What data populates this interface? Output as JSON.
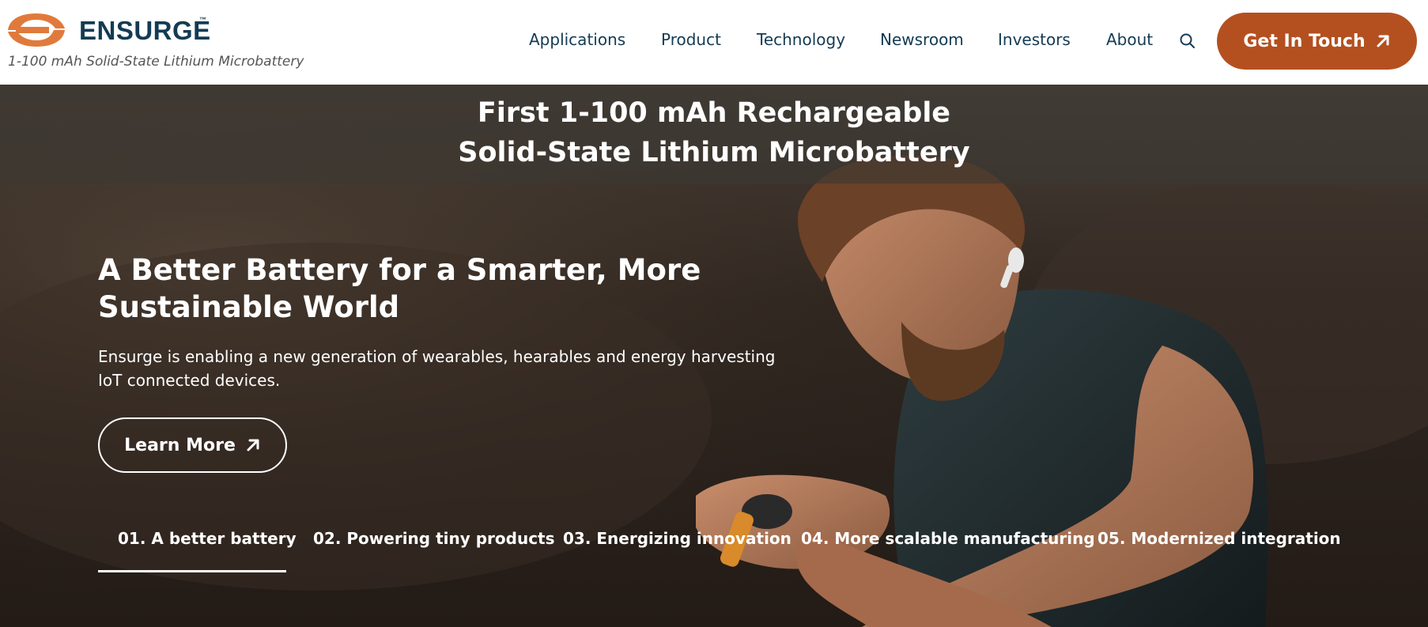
{
  "brand": {
    "name": "ENSURGE",
    "trademark": "™",
    "tagline": "1-100 mAh Solid-State Lithium Microbattery",
    "logo_icon": "ensurge-logo-mark",
    "colors": {
      "primary": "#143b54",
      "accent": "#b4501f",
      "logo_orange": "#e07a3c"
    }
  },
  "nav": {
    "items": [
      {
        "label": "Applications"
      },
      {
        "label": "Product"
      },
      {
        "label": "Technology"
      },
      {
        "label": "Newsroom"
      },
      {
        "label": "Investors"
      },
      {
        "label": "About"
      }
    ],
    "search_icon": "search-icon",
    "cta_label": "Get In Touch",
    "cta_icon": "arrow-up-right-icon"
  },
  "hero": {
    "banner_lines": [
      "First 1-100 mAh Rechargeable",
      "Solid-State Lithium Microbattery"
    ],
    "title_lines": [
      "A Better Battery for a Smarter, More",
      "Sustainable World"
    ],
    "description_lines": [
      "Ensurge is enabling a new generation of wearables, hearables and energy harvesting",
      "IoT connected devices."
    ],
    "button_label": "Learn More",
    "button_icon": "arrow-up-right-icon",
    "tabs": [
      {
        "label": "01. A better battery",
        "active": true
      },
      {
        "label": "02. Powering tiny products",
        "active": false
      },
      {
        "label": "03. Energizing innovation",
        "active": false
      },
      {
        "label": "04. More scalable manufacturing",
        "active": false
      },
      {
        "label": "05. Modernized integration",
        "active": false
      }
    ]
  }
}
